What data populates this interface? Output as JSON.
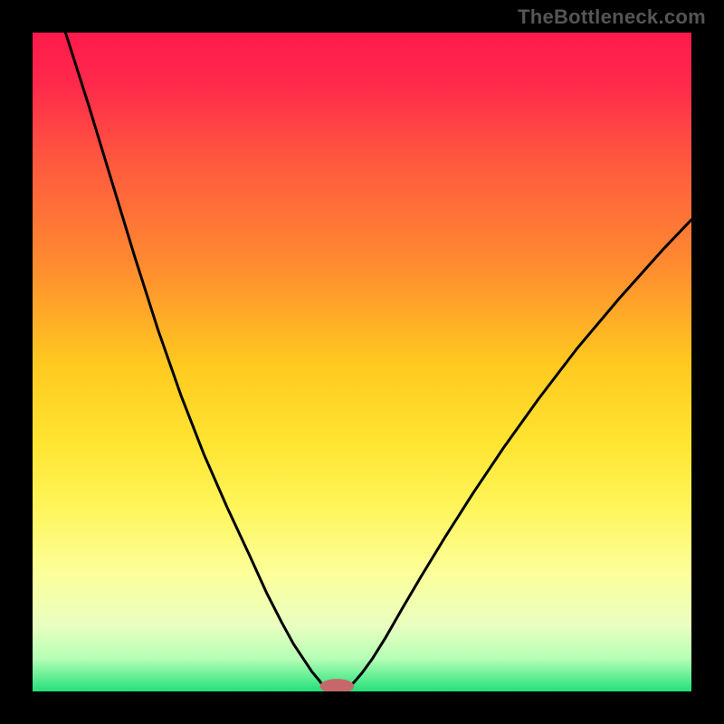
{
  "watermark": "TheBottleneck.com",
  "chart_data": {
    "type": "line",
    "title": "",
    "xlabel": "",
    "ylabel": "",
    "xlim": [
      0,
      100
    ],
    "ylim": [
      0,
      100
    ],
    "grid": false,
    "background_gradient_stops": [
      {
        "offset": 0.0,
        "color": "#ff1a4b"
      },
      {
        "offset": 0.08,
        "color": "#ff2a4b"
      },
      {
        "offset": 0.2,
        "color": "#ff5a3e"
      },
      {
        "offset": 0.35,
        "color": "#ff8a30"
      },
      {
        "offset": 0.5,
        "color": "#ffc820"
      },
      {
        "offset": 0.62,
        "color": "#ffe430"
      },
      {
        "offset": 0.72,
        "color": "#fff55a"
      },
      {
        "offset": 0.82,
        "color": "#fcff9a"
      },
      {
        "offset": 0.9,
        "color": "#e9ffc0"
      },
      {
        "offset": 0.95,
        "color": "#b6ffb6"
      },
      {
        "offset": 1.0,
        "color": "#23e07a"
      }
    ],
    "series": [
      {
        "name": "left-branch",
        "color": "#000000",
        "width": 3,
        "x": [
          5.0,
          8.5,
          12.0,
          15.5,
          19.0,
          22.5,
          26.0,
          29.5,
          33.0,
          35.5,
          37.8,
          39.6,
          41.2,
          42.4,
          43.4,
          44.0,
          44.6,
          45.0
        ],
        "y": [
          100.0,
          89.0,
          77.5,
          66.0,
          55.0,
          45.0,
          36.0,
          28.0,
          20.5,
          15.0,
          10.5,
          7.2,
          4.8,
          3.0,
          1.8,
          1.0,
          0.5,
          0.2
        ]
      },
      {
        "name": "right-branch",
        "color": "#000000",
        "width": 3,
        "x": [
          47.4,
          48.0,
          48.8,
          50.0,
          51.6,
          53.6,
          56.0,
          59.0,
          62.6,
          66.8,
          71.5,
          76.8,
          82.6,
          89.0,
          95.8,
          100.0
        ],
        "y": [
          0.2,
          0.6,
          1.4,
          2.8,
          5.0,
          8.2,
          12.4,
          17.5,
          23.4,
          30.0,
          37.0,
          44.4,
          52.0,
          59.6,
          67.2,
          71.6
        ]
      }
    ],
    "marker": {
      "name": "minimum-marker",
      "color": "#c6686a",
      "cx": 46.2,
      "cy": 0.8,
      "rx": 2.6,
      "ry": 1.1
    }
  }
}
